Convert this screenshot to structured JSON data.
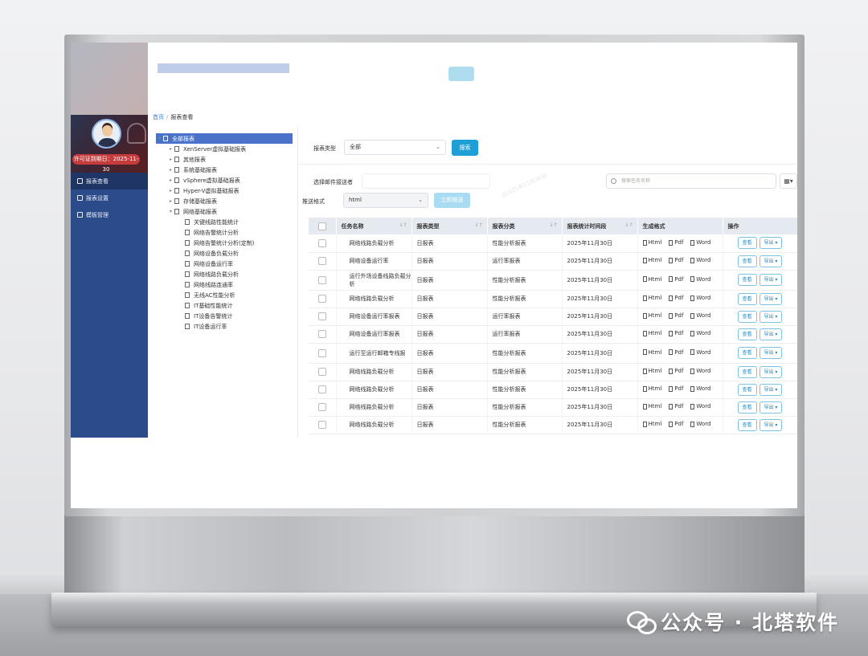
{
  "brand_watermark": "公众号 · 北塔软件",
  "sidebar": {
    "license": "许可证到期日：2025-11-30",
    "items": [
      {
        "label": "报表查看",
        "active": true
      },
      {
        "label": "报表设置",
        "active": false
      },
      {
        "label": "模板管理",
        "active": false
      }
    ]
  },
  "breadcrumb": {
    "home": "首页",
    "current": "报表查看"
  },
  "tree": {
    "root": "全部报表",
    "groups": [
      "XenServer虚拟基础报表",
      "其他报表",
      "系统基础报表",
      "vSphere虚拟基础报表",
      "Hyper-V虚拟基础报表",
      "存储基础报表",
      "网络基础报表"
    ],
    "children": [
      "关键线路性能统计",
      "网络告警统计分析",
      "网络告警统计分析(定制)",
      "网络设备负载分析",
      "网络设备运行率",
      "网络线路负载分析",
      "网络线路连通率",
      "无线AC性能分析",
      "IT基础性能统计",
      "IT设备告警统计",
      "IT设备运行率"
    ]
  },
  "filters": {
    "type_label": "报表类型",
    "type_value": "全部",
    "search_btn": "搜索",
    "email_label": "选择邮件接送者",
    "format_label": "推送格式",
    "format_value": "html",
    "push_btn": "立即推送",
    "search_placeholder": "搜索任务名称"
  },
  "watermark_text": "02025年11月30日",
  "table": {
    "headers": [
      "任务名称",
      "报表类型",
      "报表分类",
      "报表统计时间段",
      "生成格式",
      "操作"
    ],
    "formats": [
      "Html",
      "Pdf",
      "Word"
    ],
    "actions": [
      "查看",
      "导出 ▾"
    ],
    "rows": [
      {
        "name": "网络线路负载分析",
        "type": "日报表",
        "category": "性能分析报表",
        "date": "2025年11月30日"
      },
      {
        "name": "网络设备运行率",
        "type": "日报表",
        "category": "运行率报表",
        "date": "2025年11月30日"
      },
      {
        "name": "运行外场设备线路负载分析",
        "type": "日报表",
        "category": "性能分析报表",
        "date": "2025年11月30日",
        "tall": true
      },
      {
        "name": "网络线路负载分析",
        "type": "日报表",
        "category": "性能分析报表",
        "date": "2025年11月30日"
      },
      {
        "name": "网络设备运行率报表",
        "type": "日报表",
        "category": "运行率报表",
        "date": "2025年11月30日"
      },
      {
        "name": "网络设备运行率报表",
        "type": "日报表",
        "category": "运行率报表",
        "date": "2025年11月30日"
      },
      {
        "name": "运行至运行邮箱专线报",
        "type": "日报表",
        "category": "性能分析报表",
        "date": "2025年11月30日",
        "tall": true
      },
      {
        "name": "网络线路负载分析",
        "type": "日报表",
        "category": "性能分析报表",
        "date": "2025年11月30日"
      },
      {
        "name": "网络线路负载分析",
        "type": "日报表",
        "category": "性能分析报表",
        "date": "2025年11月30日"
      },
      {
        "name": "网络线路负载分析",
        "type": "日报表",
        "category": "性能分析报表",
        "date": "2025年11月30日"
      },
      {
        "name": "网络线路负载分析",
        "type": "日报表",
        "category": "性能分析报表",
        "date": "2025年11月30日"
      }
    ]
  }
}
